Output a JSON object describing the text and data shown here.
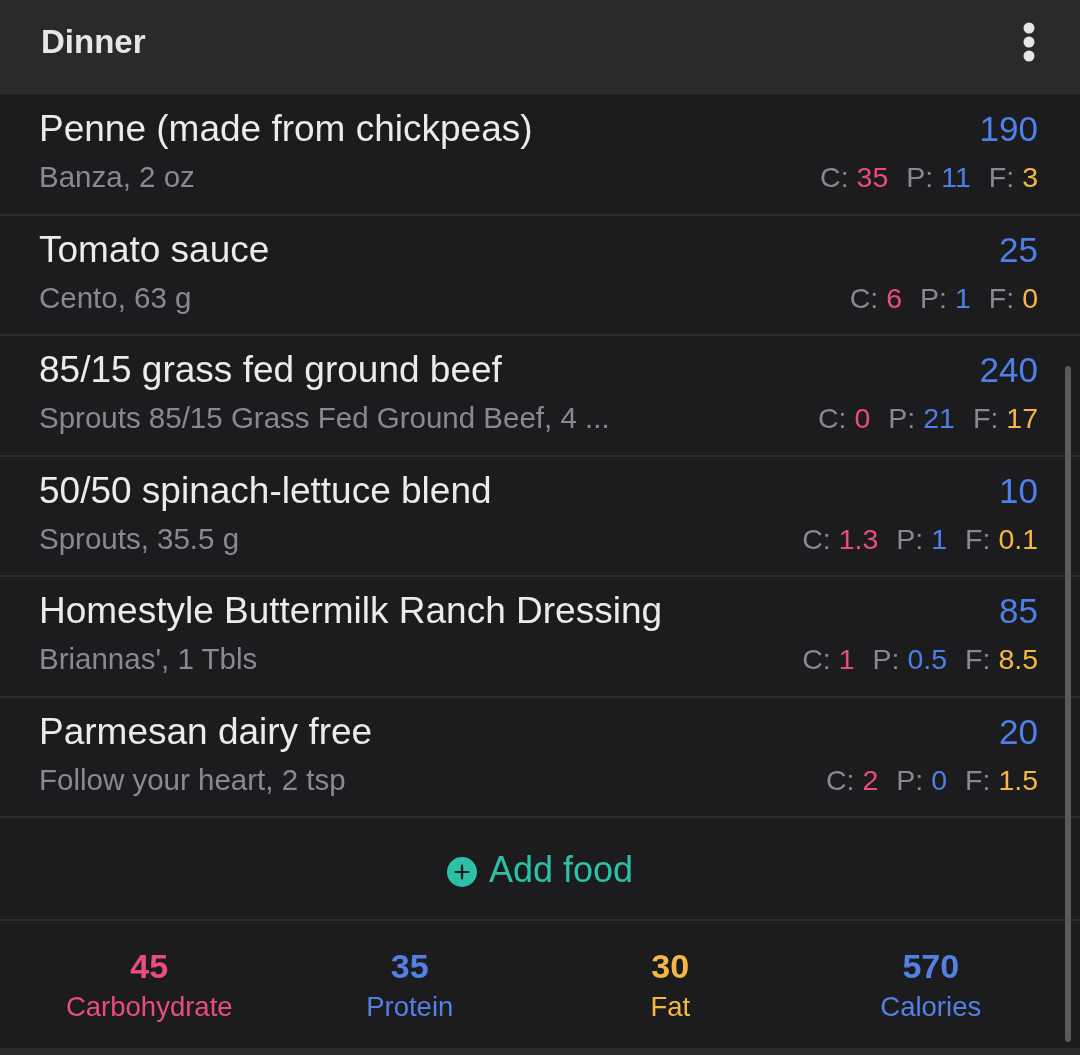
{
  "meal": {
    "title": "Dinner"
  },
  "entries": [
    {
      "name": "Penne (made from chickpeas)",
      "detail": "Banza, 2 oz",
      "calories": "190",
      "macros": [
        {
          "label": "C:",
          "value": "35",
          "color": "#ea4d7b"
        },
        {
          "label": "P:",
          "value": "11",
          "color": "#4f7fe8"
        },
        {
          "label": "F:",
          "value": "3",
          "color": "#f6b843"
        }
      ]
    },
    {
      "name": "Tomato sauce",
      "detail": "Cento, 63 g",
      "calories": "25",
      "macros": [
        {
          "label": "C:",
          "value": "6",
          "color": "#ea4d7b"
        },
        {
          "label": "P:",
          "value": "1",
          "color": "#4f7fe8"
        },
        {
          "label": "F:",
          "value": "0",
          "color": "#f6b843"
        }
      ]
    },
    {
      "name": "85/15 grass fed ground beef",
      "detail": "Sprouts 85/15 Grass Fed Ground Beef, 4 ...",
      "calories": "240",
      "macros": [
        {
          "label": "C:",
          "value": "0",
          "color": "#ea4d7b"
        },
        {
          "label": "P:",
          "value": "21",
          "color": "#4f7fe8"
        },
        {
          "label": "F:",
          "value": "17",
          "color": "#f6b843"
        }
      ]
    },
    {
      "name": "50/50 spinach-lettuce blend",
      "detail": "Sprouts, 35.5 g",
      "calories": "10",
      "macros": [
        {
          "label": "C:",
          "value": "1.3",
          "color": "#ea4d7b"
        },
        {
          "label": "P:",
          "value": "1",
          "color": "#4f7fe8"
        },
        {
          "label": "F:",
          "value": "0.1",
          "color": "#f6b843"
        }
      ]
    },
    {
      "name": "Homestyle Buttermilk Ranch Dressing",
      "detail": "Briannas', 1 Tbls",
      "calories": "85",
      "macros": [
        {
          "label": "C:",
          "value": "1",
          "color": "#ea4d7b"
        },
        {
          "label": "P:",
          "value": "0.5",
          "color": "#4f7fe8"
        },
        {
          "label": "F:",
          "value": "8.5",
          "color": "#f6b843"
        }
      ]
    },
    {
      "name": "Parmesan dairy free",
      "detail": "Follow your heart, 2 tsp",
      "calories": "20",
      "macros": [
        {
          "label": "C:",
          "value": "2",
          "color": "#ea4d7b"
        },
        {
          "label": "P:",
          "value": "0",
          "color": "#4f7fe8"
        },
        {
          "label": "F:",
          "value": "1.5",
          "color": "#f6b843"
        }
      ]
    }
  ],
  "add_food": {
    "label": "Add food"
  },
  "totals": [
    {
      "value": "45",
      "label": "Carbohydrate",
      "color": "#ea4d7b"
    },
    {
      "value": "35",
      "label": "Protein",
      "color": "#5580e3"
    },
    {
      "value": "30",
      "label": "Fat",
      "color": "#f6b843"
    },
    {
      "value": "570",
      "label": "Calories",
      "color": "#5580e3"
    }
  ]
}
